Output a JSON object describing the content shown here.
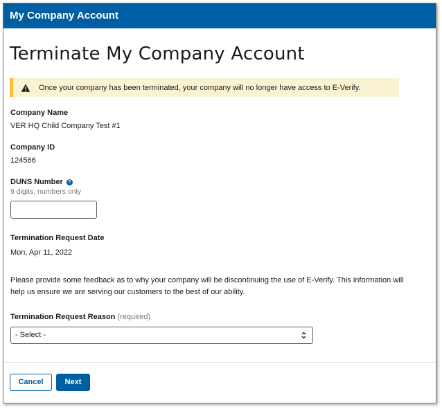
{
  "header": {
    "title": "My Company Account"
  },
  "page": {
    "title": "Terminate My Company Account"
  },
  "alert": {
    "icon": "warning-icon",
    "text": "Once your company has been terminated, your company will no longer have access to E-Verify."
  },
  "company_name": {
    "label": "Company Name",
    "value": "VER HQ Child Company Test #1"
  },
  "company_id": {
    "label": "Company ID",
    "value": "124566"
  },
  "duns": {
    "label": "DUNS Number",
    "hint": "9 digits, numbers only",
    "value": "",
    "help_icon": "help-icon"
  },
  "termination_date": {
    "label": "Termination Request Date",
    "value": "Mon, Apr 11, 2022"
  },
  "feedback": {
    "text": "Please provide some feedback as to why your company will be discontinuing the use of E-Verify. This information will help us ensure we are serving our customers to the best of our ability."
  },
  "reason": {
    "label": "Termination Request Reason",
    "required": "(required)",
    "selected": "- Select -"
  },
  "actions": {
    "cancel_label": "Cancel",
    "next_label": "Next"
  },
  "colors": {
    "primary": "#005ea2",
    "alert_bg": "#faf3d1",
    "alert_border": "#ffbe2e"
  }
}
